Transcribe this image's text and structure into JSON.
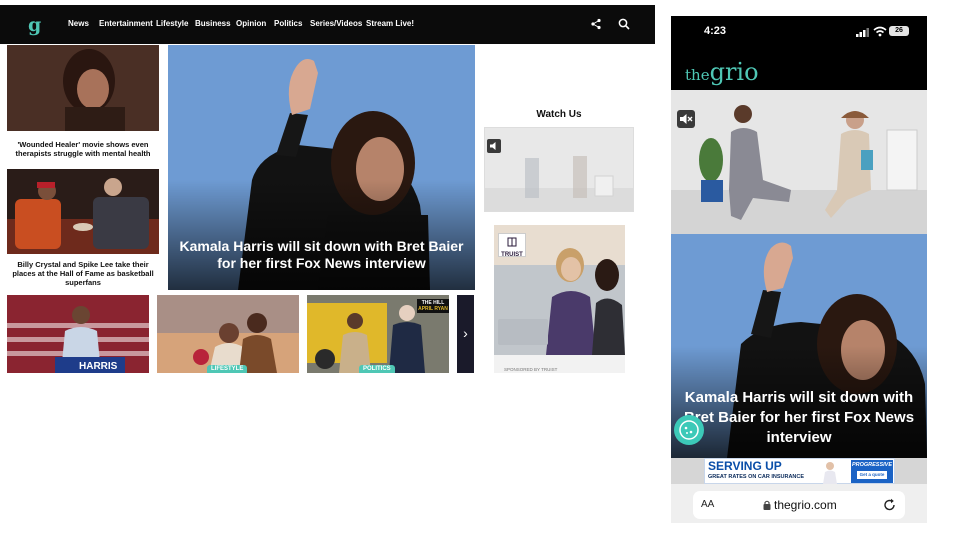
{
  "desktop": {
    "logo": "g",
    "nav": [
      "News",
      "Entertainment",
      "Lifestyle",
      "Business",
      "Opinion",
      "Politics",
      "Series/Videos",
      "Stream Live!"
    ],
    "side_stories": [
      {
        "caption": "'Wounded Healer' movie shows even therapists struggle with mental health"
      },
      {
        "caption": "Billy Crystal and Spike Lee take their places at the Hall of Fame as basketball superfans"
      }
    ],
    "hero": {
      "title": "Kamala Harris will sit down with Bret Baier for her first Fox News interview"
    },
    "watch_us": "Watch Us",
    "ad": {
      "brand": "TRUIST",
      "sponsored": "SPONSORED BY TRUIST"
    },
    "carousel": [
      {
        "tag": "",
        "sign": "HARRIS"
      },
      {
        "tag": "LIFESTYLE"
      },
      {
        "tag": "POLITICS",
        "badge_line1": "THE HILL",
        "badge_line2": "APRIL RYAN"
      }
    ],
    "carousel_next": "›",
    "colors": {
      "accent": "#4fc7b5",
      "nav_bg": "#0b0b0b"
    }
  },
  "phone": {
    "time": "4:23",
    "battery": "26",
    "logo_the": "the",
    "logo_grio": "grio",
    "hero_title": "Kamala Harris will sit down with Bret Baier for her first Fox News interview",
    "banner": {
      "headline": "SERVING UP",
      "subline": "GREAT RATES ON CAR INSURANCE",
      "brand": "PROGRESSIVE",
      "cta": "Get a quote"
    },
    "url": "thegrio.com",
    "text_size_label": "AA"
  }
}
